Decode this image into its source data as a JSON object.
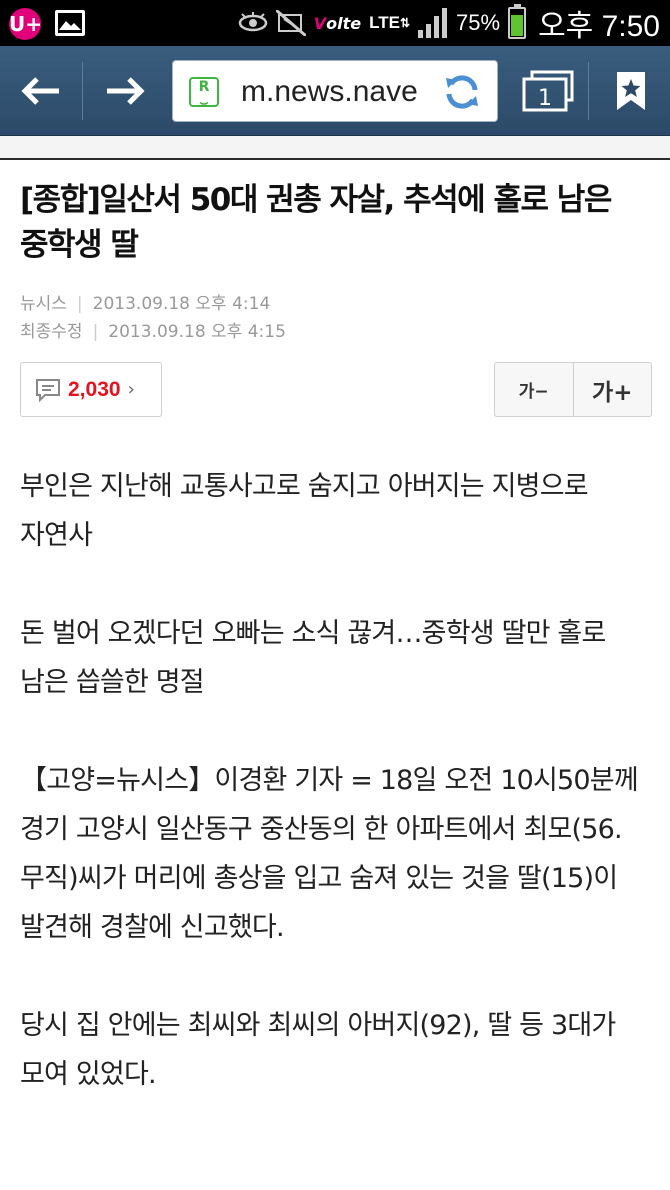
{
  "status_bar": {
    "carrier_logo": "U+",
    "volte_label": "Volte",
    "network_label": "LTE",
    "battery_percent": "75%",
    "battery_level": 0.75,
    "time": "오후 7:50",
    "icons": [
      "uplus-icon",
      "gallery-icon",
      "eye-icon",
      "mute-icon",
      "volte-icon",
      "lte-icon",
      "signal-icon",
      "battery-icon"
    ]
  },
  "toolbar": {
    "url": "m.news.nave",
    "tab_count": "1",
    "colors": {
      "bar": "#2c4a68",
      "favicon": "#3fb43f",
      "refresh": "#4a8fd4"
    }
  },
  "article": {
    "title": "[종합]일산서 50대 권총 자살, 추석에 홀로 남은 중학생 딸",
    "source": "뉴시스",
    "published": "2013.09.18 오후 4:14",
    "modified_label": "최종수정",
    "modified": "2013.09.18 오후 4:15",
    "comment_count": "2,030",
    "font_smaller": "가−",
    "font_larger": "가+",
    "comment_count_color": "#e8121f",
    "paragraphs": [
      "부인은 지난해 교통사고로 숨지고 아버지는 지병으로 자연사",
      "돈 벌어 오겠다던 오빠는 소식 끊겨…중학생 딸만 홀로 남은 씁쓸한 명절",
      "【고양=뉴시스】이경환 기자 = 18일 오전 10시50분께 경기 고양시 일산동구 중산동의 한 아파트에서 최모(56.무직)씨가 머리에 총상을 입고 숨져 있는 것을 딸(15)이 발견해 경찰에 신고했다.",
      "당시 집 안에는 최씨와 최씨의 아버지(92), 딸 등 3대가 모여 있었다."
    ]
  }
}
